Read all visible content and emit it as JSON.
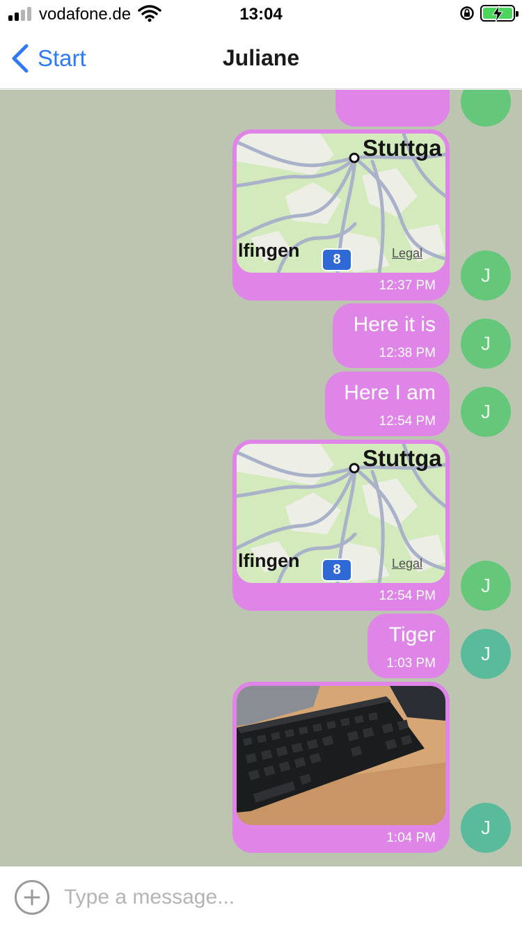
{
  "status_bar": {
    "carrier": "vodafone.de",
    "time": "13:04"
  },
  "nav": {
    "back_label": "Start",
    "title": "Juliane"
  },
  "avatar_initial": "J",
  "messages": [
    {
      "type": "location",
      "map_city": "Stuttga",
      "map_place": "lfingen",
      "map_legal": "Legal",
      "map_route": "8",
      "time": "12:37 PM"
    },
    {
      "type": "text",
      "text": "Here it is",
      "time": "12:38 PM"
    },
    {
      "type": "text",
      "text": "Here I am",
      "time": "12:54 PM"
    },
    {
      "type": "location",
      "map_city": "Stuttga",
      "map_place": "lfingen",
      "map_legal": "Legal",
      "map_route": "8",
      "time": "12:54 PM"
    },
    {
      "type": "text",
      "text": "Tiger",
      "time": "1:03 PM"
    },
    {
      "type": "photo",
      "time": "1:04 PM"
    }
  ],
  "input": {
    "placeholder": "Type a message..."
  },
  "colors": {
    "chat_background": "#bcc5b0",
    "bubble": "#e085e8",
    "avatar_green": "#65c77a",
    "avatar_teal": "#5abb9c",
    "accent": "#2f7bf6"
  }
}
